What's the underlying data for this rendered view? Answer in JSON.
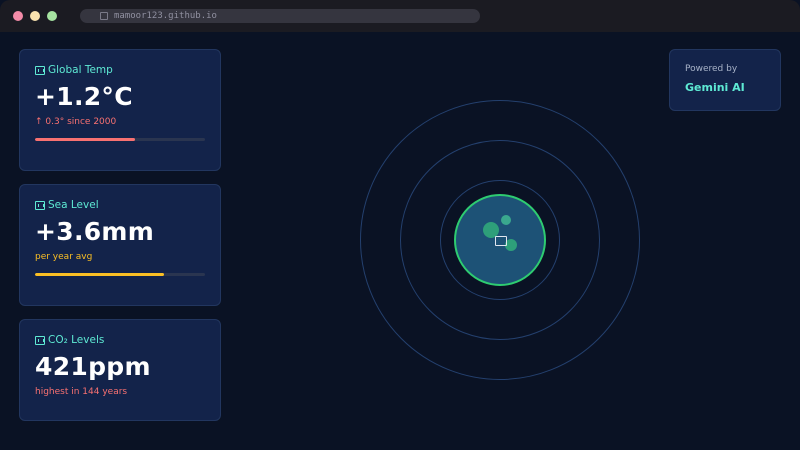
{
  "browser": {
    "url": "mamoor123.github.io"
  },
  "cards": [
    {
      "label": "Global Temp",
      "value": "+1.2°C",
      "sub": "↑ 0.3° since 2000",
      "progress": 0.59,
      "bar_color": "#f87171"
    },
    {
      "label": "Sea Level",
      "value": "+3.6mm",
      "sub": "per year avg",
      "progress": 0.76,
      "bar_color": "#fbbf24"
    },
    {
      "label": "CO₂ Levels",
      "value": "421ppm",
      "sub": "highest in 144 years"
    }
  ],
  "powered": {
    "label": "Powered by",
    "name": "Gemini AI"
  },
  "colors": {
    "background": "#0a1224",
    "card": "#13234a",
    "accent": "#5eead4",
    "globe_border": "#2ecc71"
  },
  "icons": {
    "card_icon": "glyph-box-icon",
    "globe_icon": "glyph-box-icon"
  }
}
